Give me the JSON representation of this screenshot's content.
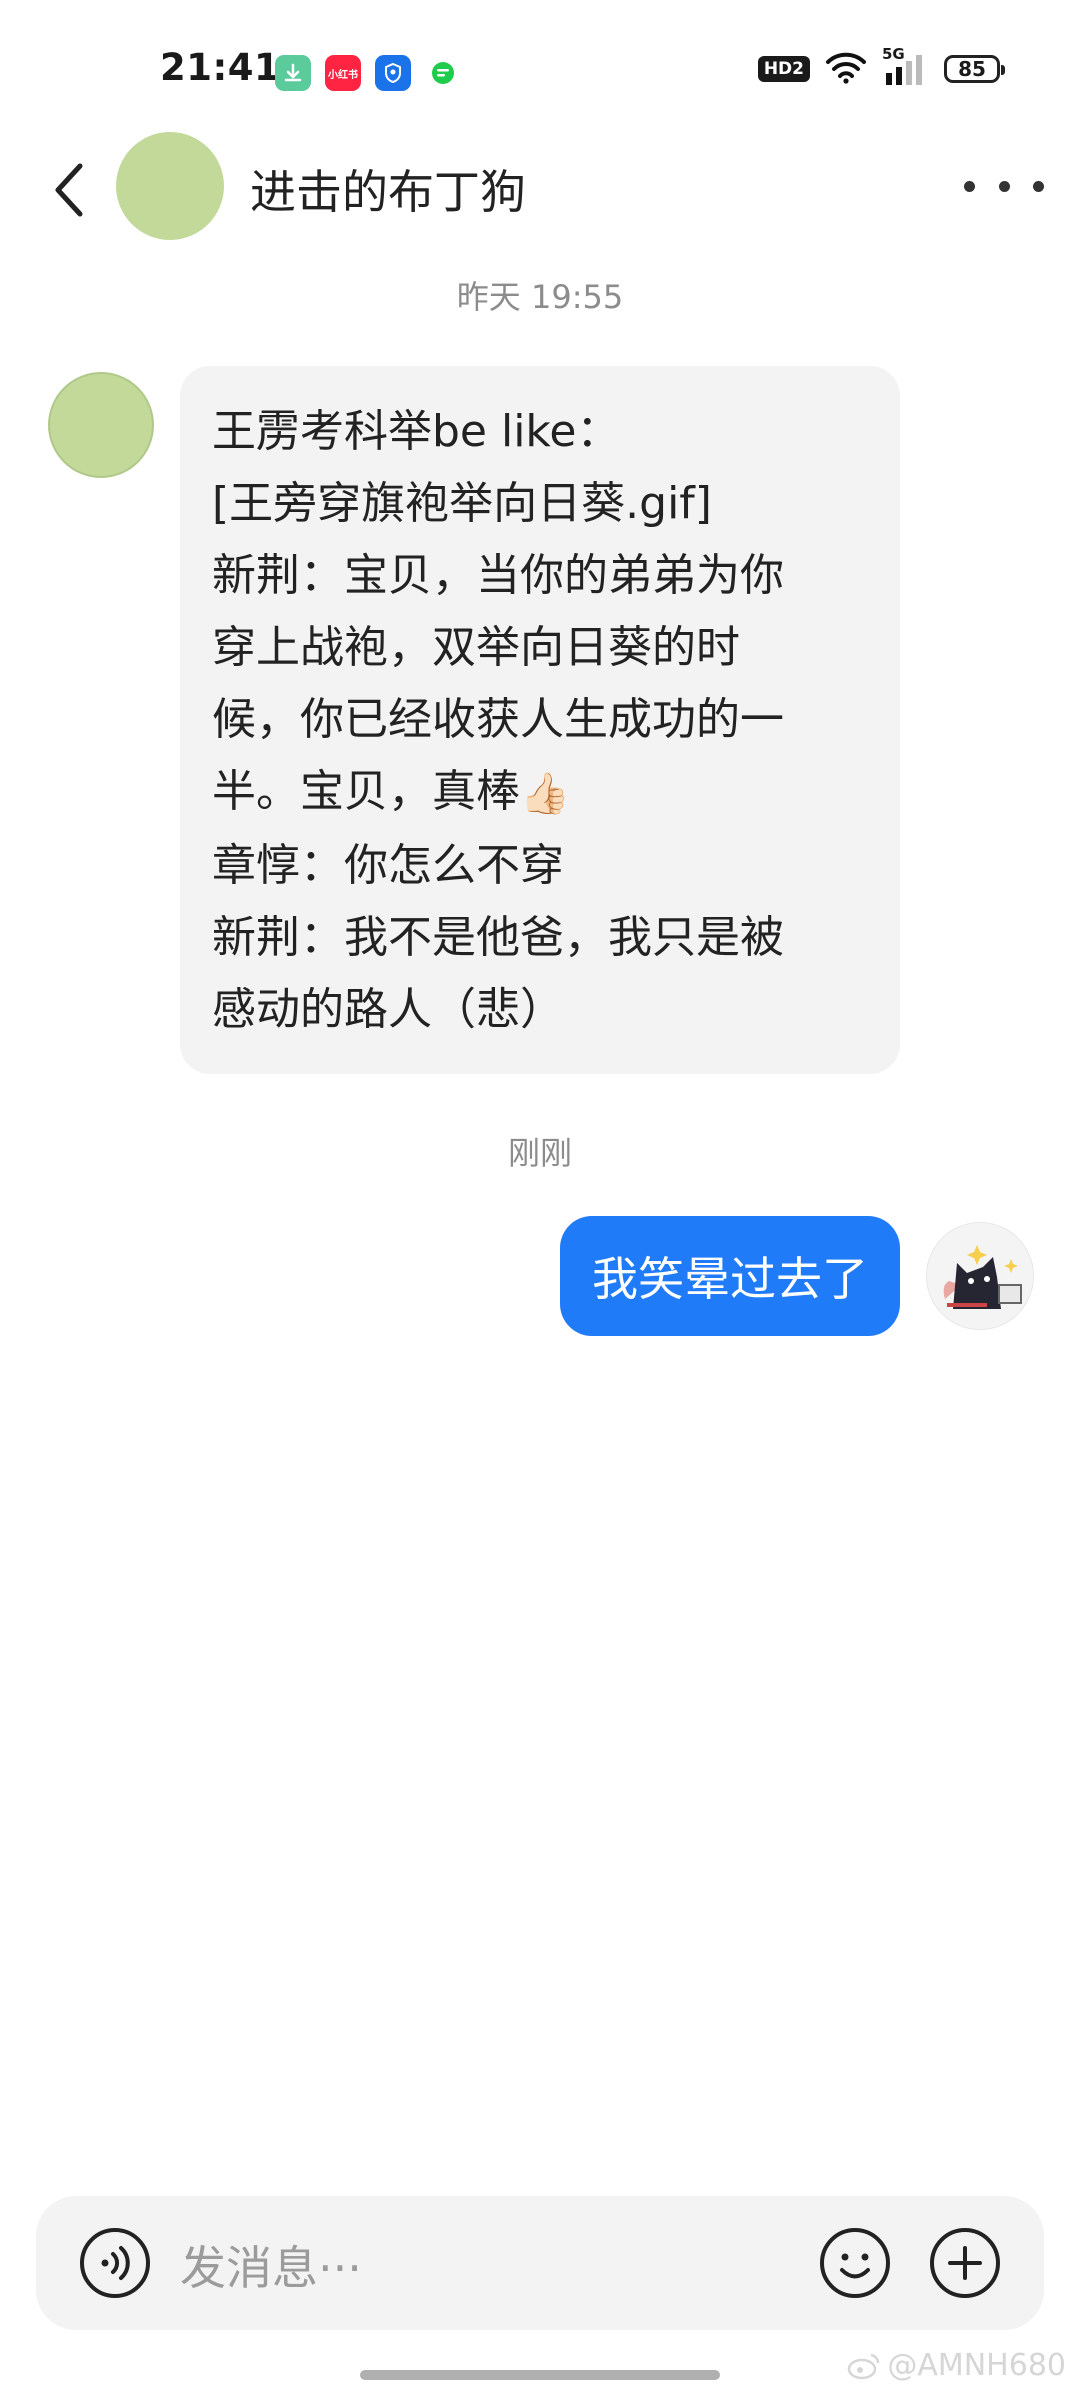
{
  "status_bar": {
    "time": "21:41",
    "app_icons": [
      {
        "name": "download-icon",
        "color": "#5ccb9c",
        "label": ""
      },
      {
        "name": "xiaohongshu-icon",
        "color": "#ff2442",
        "label": "小红书"
      },
      {
        "name": "shield-icon",
        "color": "#1a73e8",
        "label": ""
      },
      {
        "name": "chat-app-icon",
        "color": "#1fcc4b",
        "label": ""
      }
    ],
    "hd_label": "HD2",
    "network_label": "5G",
    "battery": "85"
  },
  "header": {
    "title": "进击的布丁狗",
    "avatar_color": "#c2d99a"
  },
  "messages": {
    "timestamp_1": "昨天 19:55",
    "incoming_lines": [
      "王雳考科举be like：",
      "[王旁穿旗袍举向日葵.gif]",
      "新荆：宝贝，当你的弟弟为你",
      "穿上战袍，双举向日葵的时",
      "候，你已经收获人生成功的一",
      "半。宝贝，真棒",
      "章惇：你怎么不穿",
      "新荆：我不是他爸，我只是被",
      "感动的路人（悲）"
    ],
    "thumbs_emoji": "👍🏻",
    "timestamp_2": "刚刚",
    "outgoing": "我笑晕过去了"
  },
  "input_bar": {
    "placeholder": "发消息···"
  },
  "watermark": "@AMNH680",
  "colors": {
    "accent": "#1f7bf7",
    "bubble_in": "#f3f3f3",
    "avatar": "#c2d99a"
  }
}
